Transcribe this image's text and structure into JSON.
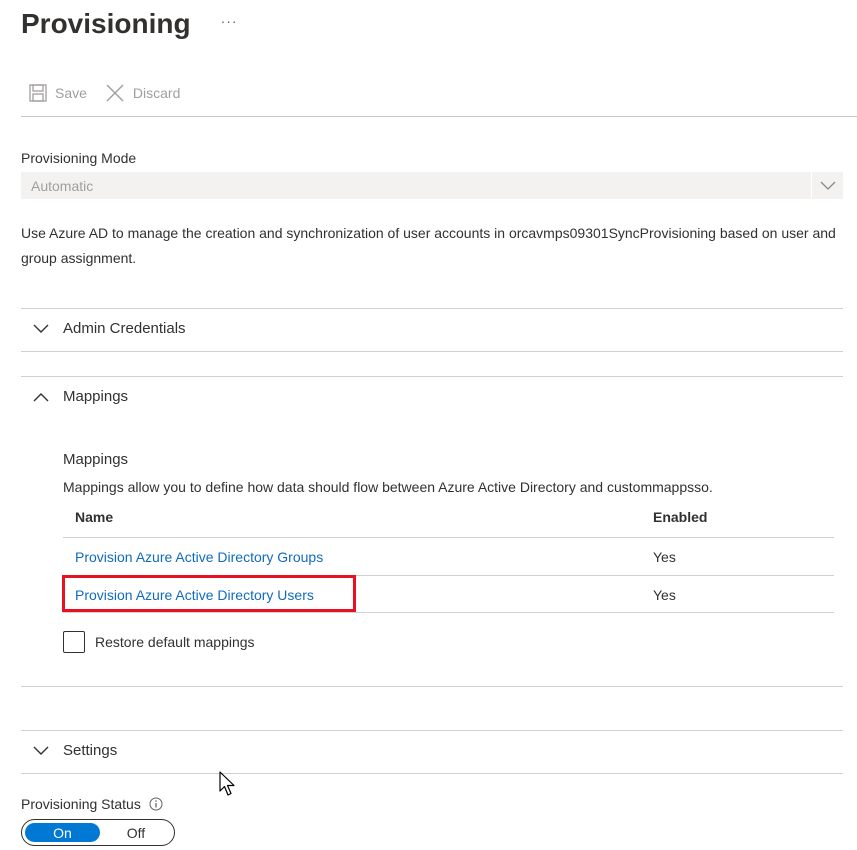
{
  "header": {
    "title": "Provisioning",
    "more_label": "···"
  },
  "toolbar": {
    "save_label": "Save",
    "discard_label": "Discard",
    "save_icon": "save-icon",
    "discard_icon": "close-icon"
  },
  "mode": {
    "label": "Provisioning Mode",
    "value": "Automatic",
    "chevron_icon": "chevron-down-icon"
  },
  "description": "Use Azure AD to manage the creation and synchronization of user accounts in orcavmps09301SyncProvisioning based on user and group assignment.",
  "sections": {
    "admin_credentials": {
      "label": "Admin Credentials",
      "expanded": false
    },
    "mappings": {
      "label": "Mappings",
      "expanded": true
    },
    "settings": {
      "label": "Settings",
      "expanded": false
    }
  },
  "mappings": {
    "subtitle": "Mappings",
    "description": "Mappings allow you to define how data should flow between Azure Active Directory and custommappsso.",
    "columns": {
      "name": "Name",
      "enabled": "Enabled"
    },
    "rows": [
      {
        "name": "Provision Azure Active Directory Groups",
        "enabled": "Yes"
      },
      {
        "name": "Provision Azure Active Directory Users",
        "enabled": "Yes",
        "highlighted": true
      }
    ],
    "restore_label": "Restore default mappings",
    "restore_checked": false
  },
  "status": {
    "label": "Provisioning Status",
    "info_icon": "info-icon",
    "on_label": "On",
    "off_label": "Off",
    "selected": "On"
  },
  "colors": {
    "accent": "#0078d4",
    "link": "#0f6cbd",
    "highlight": "#e81123"
  }
}
